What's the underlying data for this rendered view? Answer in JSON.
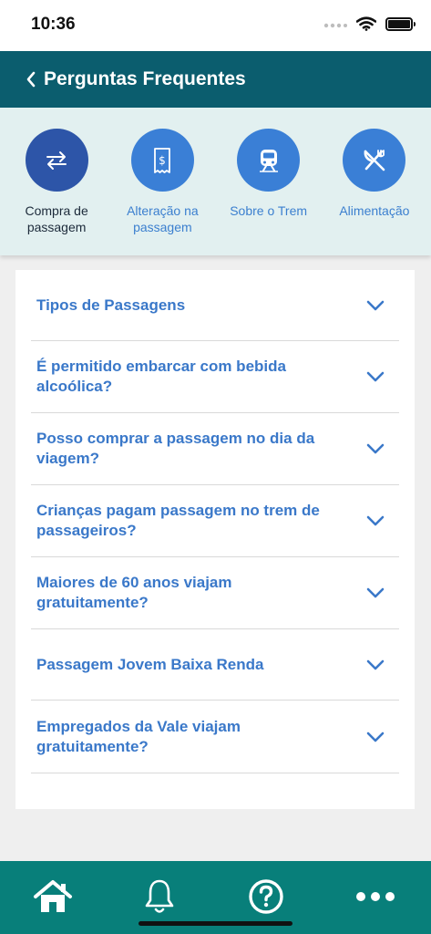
{
  "status_bar": {
    "time": "10:36"
  },
  "header": {
    "title": "Perguntas Frequentes"
  },
  "categories": [
    {
      "label_line1": "Compra de",
      "label_line2": "passagem",
      "icon": "exchange-arrows-icon",
      "active": true
    },
    {
      "label_line1": "Alteração na",
      "label_line2": "passagem",
      "icon": "ticket-dollar-icon",
      "active": false
    },
    {
      "label_line1": "Sobre o Trem",
      "label_line2": "",
      "icon": "train-icon",
      "active": false
    },
    {
      "label_line1": "Alimentação",
      "label_line2": "",
      "icon": "fork-knife-icon",
      "active": false
    }
  ],
  "faq": [
    {
      "line1": "Tipos de Passagens",
      "line2": ""
    },
    {
      "line1": "É permitido embarcar com bebida",
      "line2": "alcoólica?"
    },
    {
      "line1": "Posso comprar a passagem no dia da",
      "line2": "viagem?"
    },
    {
      "line1": "Crianças pagam passagem no trem de",
      "line2": "passageiros?"
    },
    {
      "line1": "Maiores de 60 anos viajam",
      "line2": "gratuitamente?"
    },
    {
      "line1": "Passagem Jovem Baixa Renda",
      "line2": ""
    },
    {
      "line1": "Empregados da Vale viajam",
      "line2": "gratuitamente?"
    }
  ],
  "bottom_nav": [
    {
      "icon": "home-icon"
    },
    {
      "icon": "bell-icon"
    },
    {
      "icon": "help-circle-icon"
    },
    {
      "icon": "more-dots-icon"
    }
  ],
  "colors": {
    "header_bg": "#0b5d6e",
    "nav_bg": "#087f7a",
    "accent_blue": "#3a7fd6",
    "active_blue": "#2d55a8",
    "strip_bg": "#e2f0f0"
  }
}
